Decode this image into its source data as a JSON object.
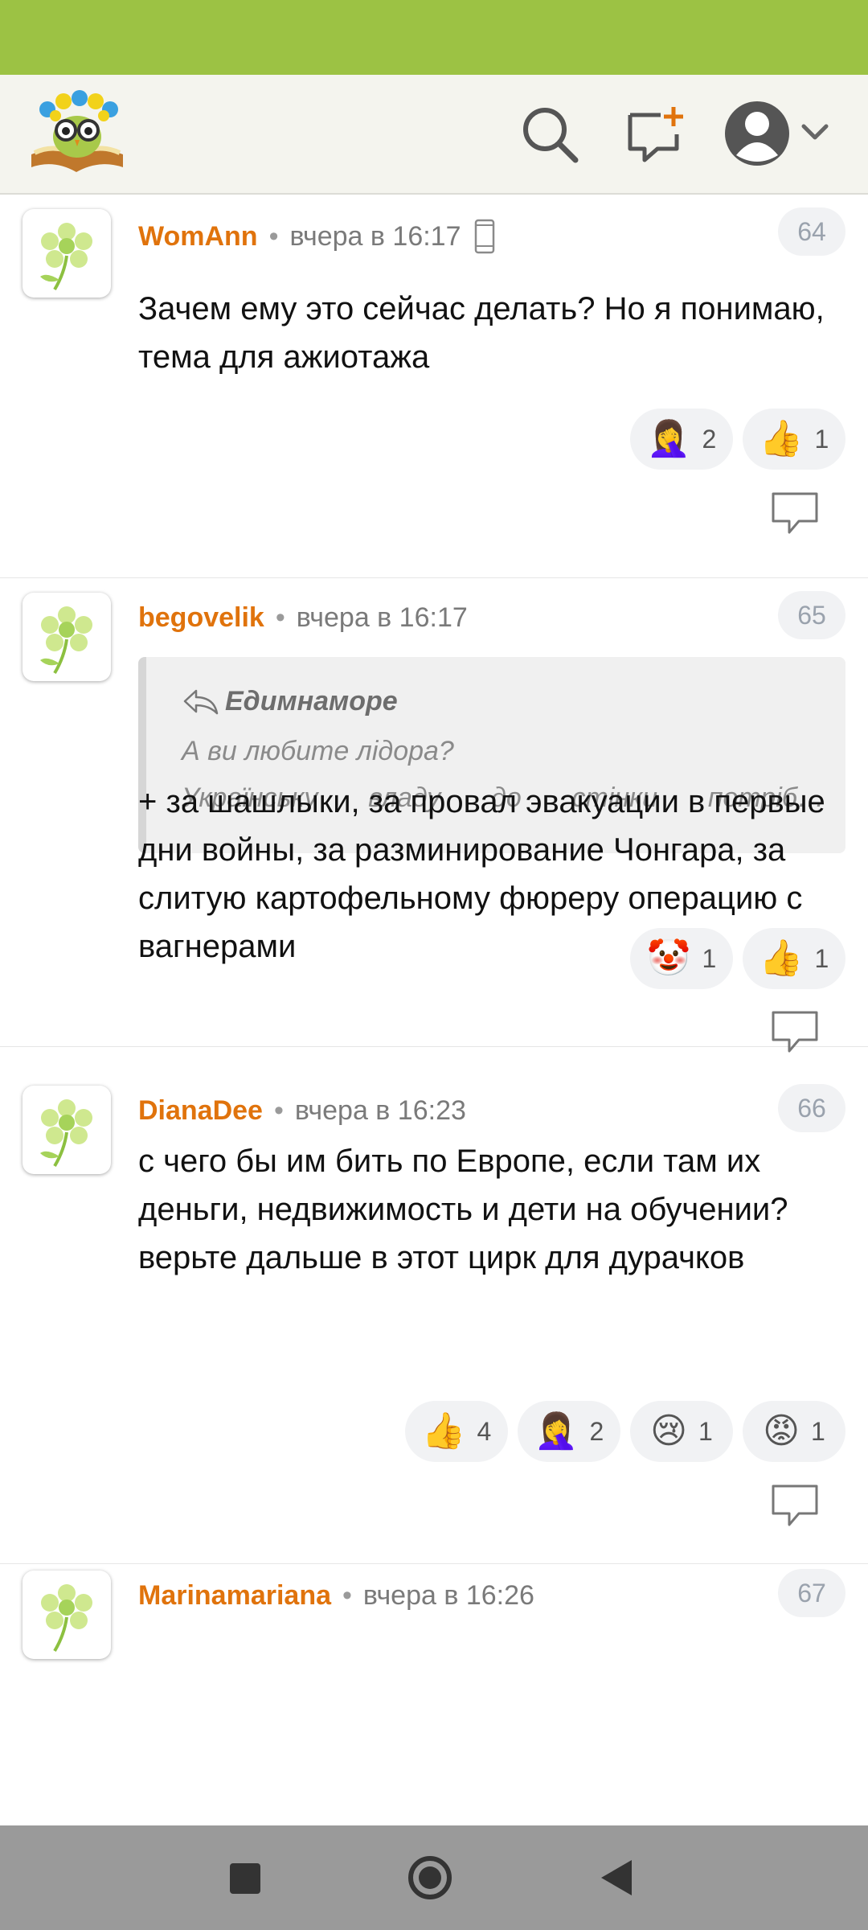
{
  "colors": {
    "accent": "#9cc244",
    "author": "#e0730c",
    "background": "#ffffff"
  },
  "header": {
    "logo": "owl-book-logo",
    "icons": [
      "search-icon",
      "new-post-icon",
      "user-avatar-icon",
      "chevron-down-icon"
    ]
  },
  "comments": [
    {
      "author": "WomAnn",
      "time": "вчера в 16:17",
      "device_icon": "mobile-phone-icon",
      "number": "64",
      "text": [
        "Зачем ему это сейчас делать? Но я понимаю, тема для ажиотажа"
      ],
      "reactions": [
        {
          "emoji": "🤦‍♀️",
          "name": "facepalm-emoji",
          "count": "2"
        },
        {
          "emoji": "👍",
          "name": "thumbs-up-emoji",
          "count": "1"
        }
      ]
    },
    {
      "author": "begovelik",
      "time": "вчера в 16:17",
      "number": "65",
      "quote": {
        "author": "Едимнаморе",
        "line1": "А ви любите лідора?",
        "line2_words": [
          "Українську",
          "владу",
          "до",
          "стінки",
          "потріб…"
        ]
      },
      "text": [
        "+ за шашлыки, за провал эвакуации в первые дни войны, за разминирование Чонгара, за слитую картофельному фюреру операцию с вагнерами"
      ],
      "reactions": [
        {
          "emoji": "🤡",
          "name": "clown-emoji",
          "count": "1"
        },
        {
          "emoji": "👍",
          "name": "thumbs-up-emoji",
          "count": "1"
        }
      ]
    },
    {
      "author": "DianaDee",
      "time": "вчера в 16:23",
      "number": "66",
      "text": [
        "с чего бы им бить по Европе, если там их деньги, недвижимость и дети на обучении?",
        "верьте дальше в этот цирк для дурачков"
      ],
      "reactions": [
        {
          "emoji": "👍",
          "name": "thumbs-up-emoji",
          "count": "4"
        },
        {
          "emoji": "🤦‍♀️",
          "name": "facepalm-emoji",
          "count": "2"
        },
        {
          "emoji": "😢",
          "name": "crying-emoji",
          "count": "1"
        },
        {
          "emoji": "😡",
          "name": "angry-emoji",
          "count": "1"
        }
      ]
    },
    {
      "author": "Marinamariana",
      "time": "вчера в 16:26",
      "number": "67"
    }
  ],
  "navbar": {
    "icons": [
      "recent-apps-icon",
      "home-icon",
      "back-icon"
    ]
  }
}
